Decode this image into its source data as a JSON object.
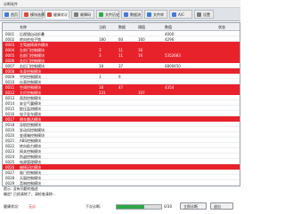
{
  "window": {
    "title": "诊断软件"
  },
  "tabs": [
    {
      "label": "首页",
      "color": "#3d7bd6"
    },
    {
      "label": "模块选择",
      "color": "#d94b3b"
    },
    {
      "label": "健康状况",
      "color": "#d94b3b"
    },
    {
      "label": "故障码",
      "color": "#7a7a7a"
    },
    {
      "label": "文件历史",
      "color": "#2ea84a"
    },
    {
      "label": "数据流",
      "color": "#3d7bd6"
    },
    {
      "label": "文件库",
      "color": "#3d7bd6"
    },
    {
      "label": "A/C",
      "color": "#3d7bd6"
    },
    {
      "label": "设置",
      "color": "#7a7a7a"
    }
  ],
  "table": {
    "headers": [
      "",
      "名称",
      "当前",
      "数据",
      "阈值",
      "数值",
      "状态"
    ],
    "rows": [
      {
        "code": "0001",
        "name": "后视镜自动折叠",
        "v1": "",
        "v2": "",
        "v3": "",
        "v4": "4000",
        "status": "",
        "style": "white"
      },
      {
        "code": "0002",
        "name": "转向柱电子锁",
        "v1": "180",
        "v2": "60",
        "v3": "160",
        "v4": "4296",
        "status": "",
        "style": "white"
      },
      {
        "code": "0003",
        "name": "主驾座椅调节模块",
        "v1": "",
        "v2": "",
        "v3": "",
        "v4": "",
        "status": "",
        "style": "red"
      },
      {
        "code": "0004",
        "name": "左前门控制模块",
        "v1": "3",
        "v2": "11",
        "v3": "16",
        "v4": "",
        "status": "",
        "style": "red"
      },
      {
        "code": "0005",
        "name": "右前门控制模块",
        "v1": "3",
        "v2": "11",
        "v3": "16",
        "v4": "5352683",
        "status": "",
        "style": "red"
      },
      {
        "code": "0006",
        "name": "左后门控制模块",
        "v1": "",
        "v2": "",
        "v3": "",
        "v4": "",
        "status": "",
        "style": "red"
      },
      {
        "code": "0007",
        "name": "右后门控制模块",
        "v1": "18",
        "v2": "37",
        "v3": "",
        "v4": "6800450",
        "status": "",
        "style": "white"
      },
      {
        "code": "0008",
        "name": "车身控制模块",
        "v1": "",
        "v2": "",
        "v3": "",
        "v4": "",
        "status": "",
        "style": "red"
      },
      {
        "code": "0009",
        "name": "中央控制模块",
        "v1": "3",
        "v2": "9",
        "v3": "",
        "v4": "",
        "status": "",
        "style": "white"
      },
      {
        "code": "0010",
        "name": "仪表控制模块",
        "v1": "",
        "v2": "",
        "v3": "",
        "v4": "",
        "status": "",
        "style": "white"
      },
      {
        "code": "0011",
        "name": "空调控制模块",
        "v1": "18",
        "v2": "47",
        "v3": "",
        "v4": "4354",
        "status": "",
        "style": "red"
      },
      {
        "code": "0012",
        "name": "大灯控制模块",
        "v1": "231",
        "v2": "",
        "v3": "107",
        "v4": "",
        "status": "",
        "style": "red"
      },
      {
        "code": "0013",
        "name": "雨刮控制模块",
        "v1": "",
        "v2": "",
        "v3": "",
        "v4": "",
        "status": "",
        "style": "white"
      },
      {
        "code": "0014",
        "name": "安全气囊模块",
        "v1": "",
        "v2": "",
        "v3": "",
        "v4": "",
        "status": "",
        "style": "white"
      },
      {
        "code": "0015",
        "name": "胎压监测模块",
        "v1": "",
        "v2": "",
        "v3": "",
        "v4": "",
        "status": "",
        "style": "white"
      },
      {
        "code": "0016",
        "name": "电子驻车模块",
        "v1": "",
        "v2": "",
        "v3": "",
        "v4": "",
        "status": "",
        "style": "white"
      },
      {
        "code": "0017",
        "name": "倒车雷达模块",
        "v1": "",
        "v2": "",
        "v3": "",
        "v4": "",
        "status": "",
        "style": "red"
      },
      {
        "code": "0018",
        "name": "导航控制模块",
        "v1": "",
        "v2": "",
        "v3": "",
        "v4": "",
        "status": "",
        "style": "white"
      },
      {
        "code": "0019",
        "name": "发动机控制模块",
        "v1": "",
        "v2": "",
        "v3": "",
        "v4": "",
        "status": "",
        "style": "white"
      },
      {
        "code": "0020",
        "name": "变速箱控制模块",
        "v1": "",
        "v2": "",
        "v3": "",
        "v4": "",
        "status": "",
        "style": "white"
      },
      {
        "code": "0021",
        "name": "ABS控制模块",
        "v1": "",
        "v2": "",
        "v3": "",
        "v4": "",
        "status": "",
        "style": "white"
      },
      {
        "code": "0022",
        "name": "转向助力模块",
        "v1": "",
        "v2": "",
        "v3": "",
        "v4": "",
        "status": "",
        "style": "white"
      },
      {
        "code": "0023",
        "name": "网关控制模块",
        "v1": "",
        "v2": "",
        "v3": "",
        "v4": "",
        "status": "",
        "style": "white"
      },
      {
        "code": "0024",
        "name": "防盗控制模块",
        "v1": "",
        "v2": "",
        "v3": "",
        "v4": "",
        "status": "",
        "style": "white"
      },
      {
        "code": "0025",
        "name": "电源管理模块",
        "v1": "",
        "v2": "",
        "v3": "",
        "v4": "",
        "status": "",
        "style": "white"
      },
      {
        "code": "0026",
        "name": "座椅记忆模块",
        "v1": "",
        "v2": "",
        "v3": "",
        "v4": "",
        "status": "",
        "style": "red"
      },
      {
        "code": "0027",
        "name": "尾门控制模块",
        "v1": "",
        "v2": "",
        "v3": "",
        "v4": "",
        "status": "",
        "style": "white"
      },
      {
        "code": "0028",
        "name": "天窗控制模块",
        "v1": "",
        "v2": "",
        "v3": "",
        "v4": "",
        "status": "",
        "style": "white"
      },
      {
        "code": "0029",
        "name": "音响控制模块",
        "v1": "",
        "v2": "",
        "v3": "",
        "v4": "",
        "status": "",
        "style": "white"
      }
    ]
  },
  "bottom": {
    "line1": "提示: 没有问题的描述",
    "line2": "确定! 已经清除了，请检查清除...",
    "status_label": "健康状况:",
    "status_value": "无诊",
    "progress_label": "下次诊断:",
    "progress_pct": 0.62,
    "progress_text": "0/30",
    "button1": "立即诊断",
    "button2": "退出"
  },
  "colors": {
    "red": "#e8222b",
    "accent": "#2ea84a"
  }
}
